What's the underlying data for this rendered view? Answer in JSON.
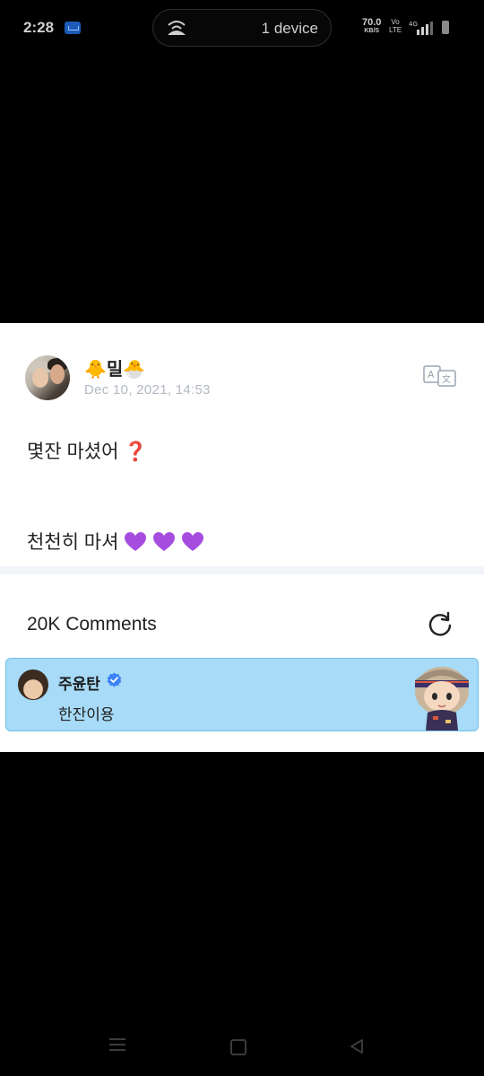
{
  "status_bar": {
    "time": "2:28",
    "hotspot_label": "1 device",
    "net_speed_value": "70.0",
    "net_speed_unit": "KB/S",
    "volte_top": "Vo",
    "volte_bottom": "LTE",
    "network_type": "4G",
    "icons": [
      "app-notification-icon",
      "hotspot-icon",
      "signal-icon",
      "battery-icon"
    ]
  },
  "post": {
    "user_name": "🐥밀🐣",
    "date": "Dec 10, 2021, 14:53",
    "line1_text": "몇잔 마셨어",
    "line1_emoji": "❓",
    "line2_text": "천천히 마셔",
    "heart_count": 3,
    "icons": [
      "translate-icon"
    ]
  },
  "comments": {
    "count_label": "20K Comments",
    "items": [
      {
        "author": "주윤탄",
        "verified": true,
        "text": "한잔이용"
      }
    ]
  },
  "nav_bar": {
    "icons": [
      "menu-icon",
      "home-icon",
      "back-icon"
    ]
  },
  "colors": {
    "background": "#000000",
    "card": "#ffffff",
    "comment_highlight": "#a7dbf7",
    "heart": "#a64de0",
    "verified": "#3b82f6",
    "date": "#b3b8c3"
  }
}
